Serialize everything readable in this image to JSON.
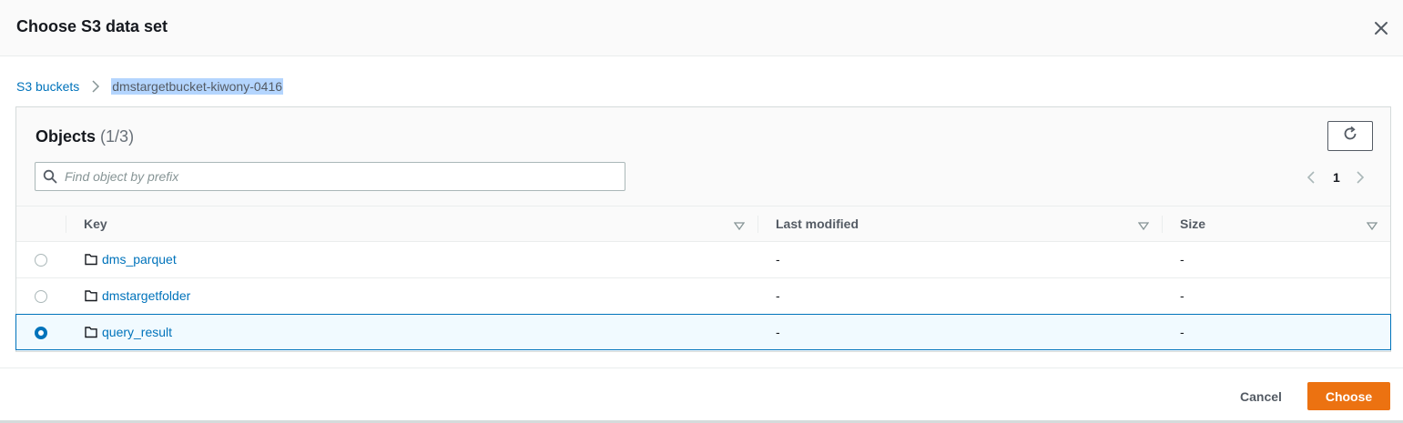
{
  "modal": {
    "title": "Choose S3 data set",
    "close_icon": "close-icon"
  },
  "breadcrumb": {
    "root_label": "S3 buckets",
    "separator_icon": "chevron-right-icon",
    "current_label": "dmstargetbucket-kiwony-0416"
  },
  "objects": {
    "title": "Objects",
    "count": "(1/3)",
    "refresh_icon": "refresh-icon",
    "search": {
      "icon": "search-icon",
      "placeholder": "Find object by prefix",
      "value": ""
    },
    "pagination": {
      "prev_icon": "chevron-left-icon",
      "page": "1",
      "next_icon": "chevron-right-icon"
    }
  },
  "table": {
    "columns": [
      "Key",
      "Last modified",
      "Size"
    ],
    "rows": [
      {
        "key": "dms_parquet",
        "last_modified": "-",
        "size": "-",
        "selected": false
      },
      {
        "key": "dmstargetfolder",
        "last_modified": "-",
        "size": "-",
        "selected": false
      },
      {
        "key": "query_result",
        "last_modified": "-",
        "size": "-",
        "selected": true
      }
    ]
  },
  "footer": {
    "cancel_label": "Cancel",
    "choose_label": "Choose"
  },
  "colors": {
    "link": "#0073bb",
    "primary_button": "#ec7211",
    "selected_row_bg": "#f1faff",
    "selected_row_border": "#0073bb"
  }
}
